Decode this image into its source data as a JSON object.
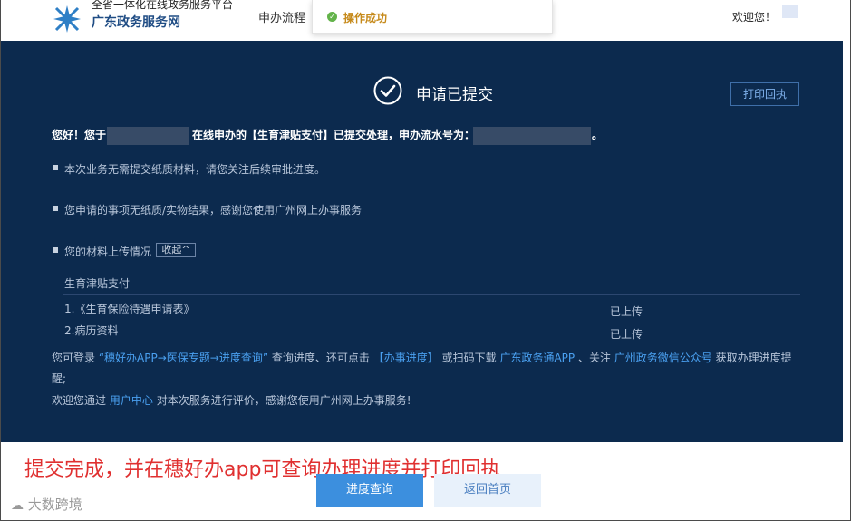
{
  "header": {
    "site_subtitle": "全省一体化在线政务服务平台",
    "site_title": "广东政务服务网",
    "nav_item": "申办流程",
    "welcome": "欢迎您！"
  },
  "toast": {
    "text": "操作成功",
    "icon": "check-icon"
  },
  "panel": {
    "title": "申请已提交",
    "print_button": "打印回执",
    "greet_start": "您好！您于",
    "greet_mid": "在线申办的【生育津贴支付】已提交处理，申办流水号为：",
    "greet_end": "。",
    "notice_1": "本次业务无需提交纸质材料，请您关注后续审批进度。",
    "notice_2": "您申请的事项无纸质/实物结果，感谢您使用广州网上办事服务",
    "materials_label": "您的材料上传情况",
    "collapse_button": "收起^",
    "materials_group": "生育津贴支付",
    "materials": [
      {
        "name": "1.《生育保险待遇申请表》",
        "status": "已上传"
      },
      {
        "name": "2.病历资料",
        "status": "已上传"
      }
    ],
    "info": {
      "p1": "您可登录",
      "link1": "“穗好办APP→医保专题→进度查询”",
      "p2": "查询进度、还可点击",
      "link2": "【办事进度】",
      "p3": "或扫码下载",
      "link3": "广东政务通APP",
      "p4": "、关注",
      "link4": "广州政务微信公众号",
      "p5": "获取办理进度提",
      "p6": "醒;"
    },
    "eval": {
      "p1": "欢迎您通过",
      "link": "用户中心",
      "p2": "对本次服务进行评价，感谢您使用广州网上办事服务!"
    }
  },
  "caption": "提交完成，并在穗好办app可查询办理进度并打印回执",
  "buttons": {
    "query": "进度查询",
    "home": "返回首页"
  },
  "watermark": "大数跨境",
  "colors": {
    "panel_bg": "#0c2a4e",
    "link": "#4aa0f0",
    "primary": "#3c8fde",
    "caption": "#e03030"
  }
}
